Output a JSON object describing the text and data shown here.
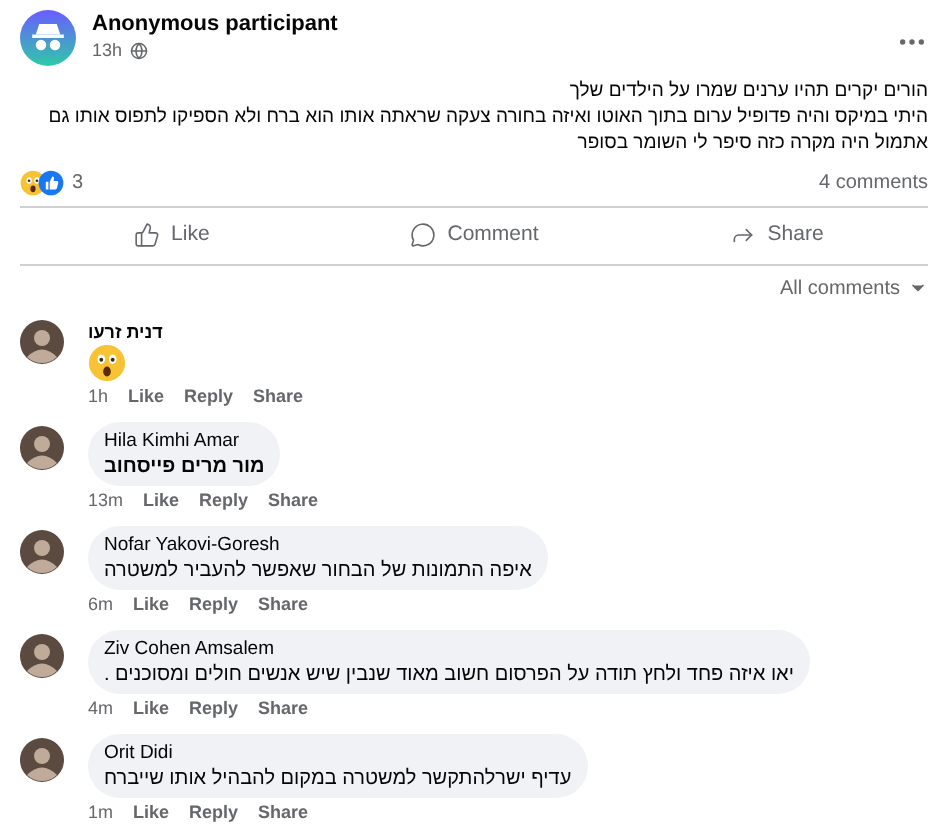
{
  "post": {
    "author": "Anonymous participant",
    "time": "13h",
    "body": [
      "הורים יקרים תהיו ערנים שמרו על הילדים שלך",
      "היתי במיקס והיה פדופיל ערום בתוך האוטו ואיזה בחורה צעקה שראתה אותו הוא ברח ולא הספיקו לתפוס  אותו גם",
      "אתמול היה מקרה כזה  סיפר לי השומר בסופר"
    ],
    "reaction_count": "3",
    "comment_count": "4 comments"
  },
  "actions": [
    "Like",
    "Comment",
    "Share"
  ],
  "filter": "All comments",
  "comments": [
    {
      "kind": "sticker",
      "author": "דנית זרעו",
      "time": "1h",
      "actions": [
        "Like",
        "Reply",
        "Share"
      ]
    },
    {
      "kind": "text",
      "author": "Hila Kimhi Amar",
      "text": "מור מרים פייסחוב",
      "bold": true,
      "time": "13m",
      "actions": [
        "Like",
        "Reply",
        "Share"
      ]
    },
    {
      "kind": "text",
      "author": "Nofar Yakovi-Goresh",
      "text": "איפה התמונות של הבחור שאפשר להעביר למשטרה",
      "bold": false,
      "time": "6m",
      "actions": [
        "Like",
        "Reply",
        "Share"
      ]
    },
    {
      "kind": "text",
      "author": "Ziv Cohen Amsalem",
      "text": "יאו איזה פחד ולחץ תודה על הפרסום חשוב מאוד שנבין שיש אנשים חולים ומסוכנים .",
      "bold": false,
      "time": "4m",
      "actions": [
        "Like",
        "Reply",
        "Share"
      ]
    },
    {
      "kind": "text",
      "author": "Orit Didi",
      "text": "עדיף ישרלהתקשר למשטרה במקום להבהיל אותו שייברח",
      "bold": false,
      "time": "1m",
      "actions": [
        "Like",
        "Reply",
        "Share"
      ]
    }
  ]
}
